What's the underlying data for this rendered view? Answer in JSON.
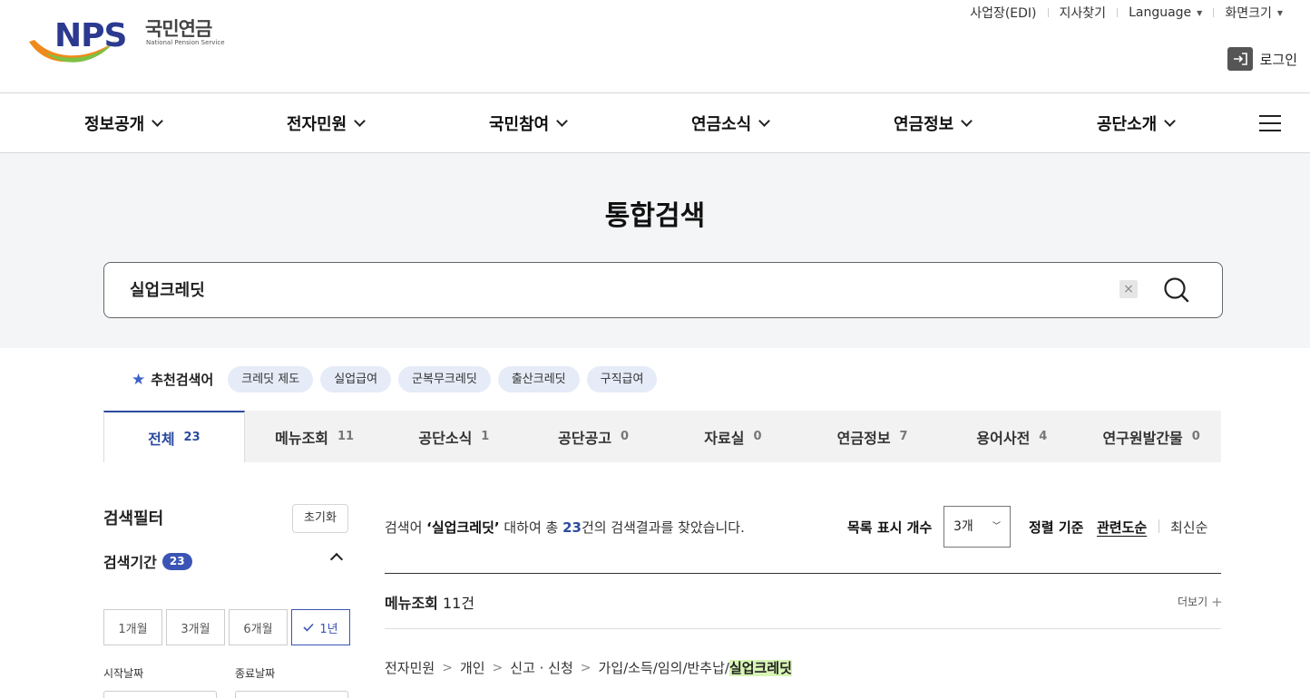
{
  "header": {
    "logo_text": "NPS",
    "logo_kr": "국민연금",
    "logo_en": "National Pension Service",
    "util_links": [
      "사업장(EDI)",
      "지사찾기",
      "Language",
      "화면크기"
    ],
    "login_label": "로그인"
  },
  "gnb": {
    "items": [
      "정보공개",
      "전자민원",
      "국민참여",
      "연금소식",
      "연금정보",
      "공단소개"
    ]
  },
  "search": {
    "title": "통합검색",
    "query": "실업크레딧",
    "clear_label": "×"
  },
  "recommended": {
    "label": "추천검색어",
    "keywords": [
      "크레딧 제도",
      "실업급여",
      "군복무크레딧",
      "출산크레딧",
      "구직급여"
    ]
  },
  "tabs": [
    {
      "label": "전체",
      "count": "23",
      "active": true
    },
    {
      "label": "메뉴조회",
      "count": "11"
    },
    {
      "label": "공단소식",
      "count": "1"
    },
    {
      "label": "공단공고",
      "count": "0"
    },
    {
      "label": "자료실",
      "count": "0"
    },
    {
      "label": "연금정보",
      "count": "7"
    },
    {
      "label": "용어사전",
      "count": "4"
    },
    {
      "label": "연구원발간물",
      "count": "0"
    }
  ],
  "filter": {
    "title": "검색필터",
    "reset_label": "초기화",
    "period_title": "검색기간",
    "period_count": "23",
    "periods": [
      "1개월",
      "3개월",
      "6개월",
      "1년"
    ],
    "selected_period": "1년",
    "start_label": "시작날짜",
    "end_label": "종료날짜"
  },
  "results": {
    "summary_prefix": "검색어 ",
    "summary_query": "‘실업크레딧’",
    "summary_mid": " 대하여 총 ",
    "summary_count": "23",
    "summary_suffix": "건의 검색결과를 찾았습니다.",
    "list_count_label": "목록 표시 개수",
    "list_count_value": "3개",
    "sort_label": "정렬 기준",
    "sort_relevance": "관련도순",
    "sort_latest": "최신순",
    "section_title": "메뉴조회",
    "section_count": "11건",
    "more_label": "더보기",
    "breadcrumb": [
      "전자민원",
      "개인",
      "신고 · 신청"
    ],
    "breadcrumb_last_prefix": "가입/소득/임의/반추납/",
    "breadcrumb_highlight": "실업크레딧"
  }
}
